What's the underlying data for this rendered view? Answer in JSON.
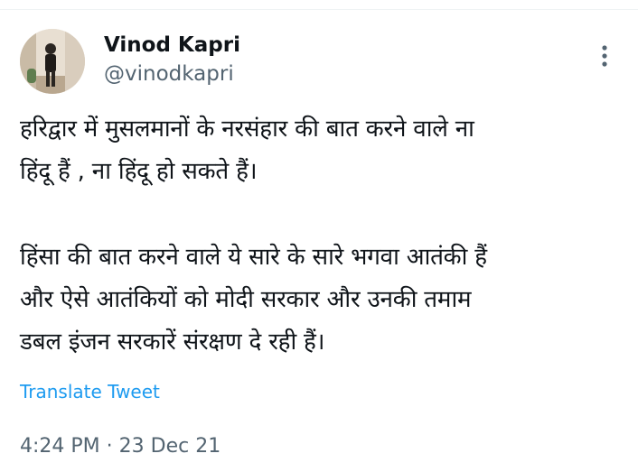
{
  "author": {
    "display_name": "Vinod Kapri",
    "handle": "@vinodkapri"
  },
  "tweet": {
    "paragraphs": [
      [
        "हरिद्वार में मुसलमानों के नरसंहार की बात करने वाले ना",
        "हिंदू हैं , ना हिंदू हो सकते हैं।"
      ],
      [
        "हिंसा की बात करने वाले ये सारे के सारे भगवा आतंकी हैं",
        "और ऐसे आतंकियों को मोदी सरकार और उनकी तमाम",
        "डबल इंजन सरकारें संरक्षण दे रही हैं।"
      ]
    ],
    "translate_label": "Translate Tweet",
    "time": "4:24 PM",
    "separator": "·",
    "date": "23 Dec 21"
  },
  "icons": {
    "avatar": "profile-photo",
    "more": "more-vertical-icon"
  },
  "colors": {
    "text": "#0f1419",
    "secondary": "#536471",
    "link": "#1d9bf0"
  }
}
